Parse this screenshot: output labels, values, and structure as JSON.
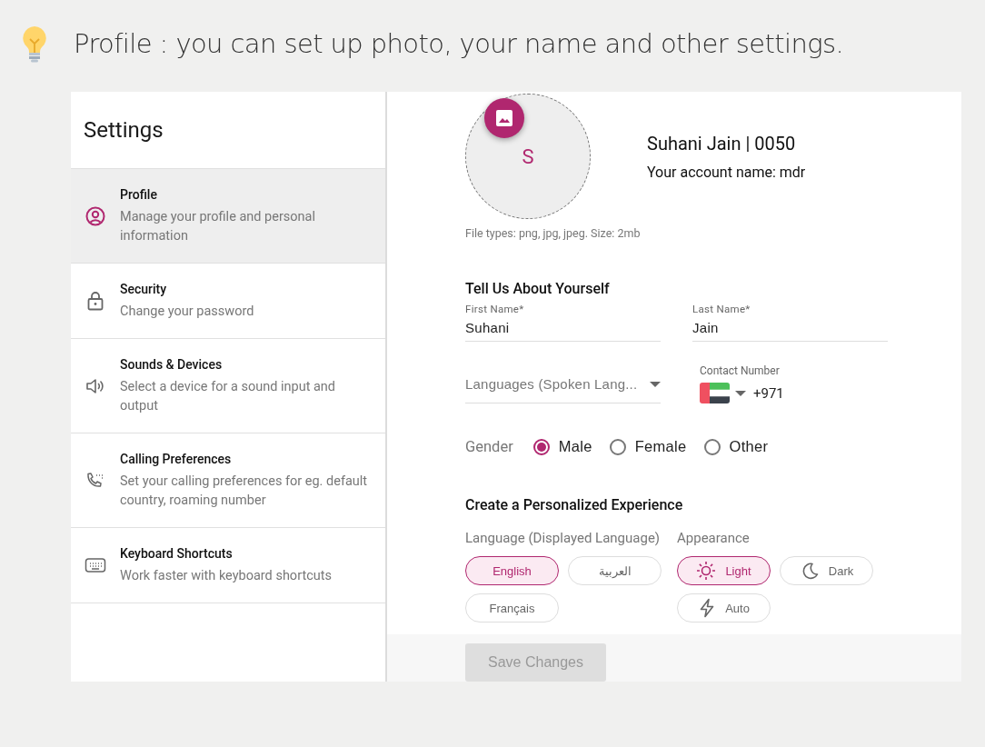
{
  "hint": {
    "text": "Profile : you can set up photo, your name and other settings."
  },
  "sidebar": {
    "title": "Settings",
    "items": [
      {
        "kind": "profile",
        "title": "Profile",
        "description": "Manage your profile and personal information",
        "selected": true
      },
      {
        "kind": "security",
        "title": "Security",
        "description": "Change your password",
        "selected": false
      },
      {
        "kind": "sound",
        "title": "Sounds & Devices",
        "description": "Select a device for a sound input and output",
        "selected": false
      },
      {
        "kind": "calling",
        "title": "Calling Preferences",
        "description": "Set your calling preferences for eg. default country, roaming number",
        "selected": false
      },
      {
        "kind": "keyboard",
        "title": "Keyboard Shortcuts",
        "description": "Work faster with keyboard shortcuts",
        "selected": false
      }
    ]
  },
  "profile": {
    "initial": "S",
    "name": "Suhani Jain | 0050",
    "account": "Your account name: mdr",
    "file_types": "File types: png, jpg, jpeg. Size: 2mb"
  },
  "about": {
    "heading": "Tell Us About Yourself",
    "first_name": {
      "label": "First Name*",
      "value": "Suhani"
    },
    "last_name": {
      "label": "Last Name*",
      "value": "Jain"
    },
    "languages": {
      "placeholder": "Languages (Spoken Lang..."
    },
    "contact": {
      "label": "Contact Number",
      "value": "+971"
    },
    "gender": {
      "label": "Gender",
      "options": [
        {
          "label": "Male",
          "selected": true
        },
        {
          "label": "Female",
          "selected": false
        },
        {
          "label": "Other",
          "selected": false
        }
      ]
    }
  },
  "experience": {
    "heading": "Create a Personalized Experience",
    "language": {
      "label": "Language (Displayed Language)",
      "options": [
        {
          "label": "English",
          "selected": true
        },
        {
          "label": "العربية",
          "selected": false
        },
        {
          "label": "Français",
          "selected": false
        }
      ]
    },
    "appearance": {
      "label": "Appearance",
      "options": [
        {
          "kind": "light",
          "label": "Light",
          "selected": true
        },
        {
          "kind": "dark",
          "label": "Dark",
          "selected": false
        },
        {
          "kind": "auto",
          "label": "Auto",
          "selected": false
        }
      ]
    }
  },
  "save_button": {
    "label": "Save Changes",
    "disabled": true
  }
}
